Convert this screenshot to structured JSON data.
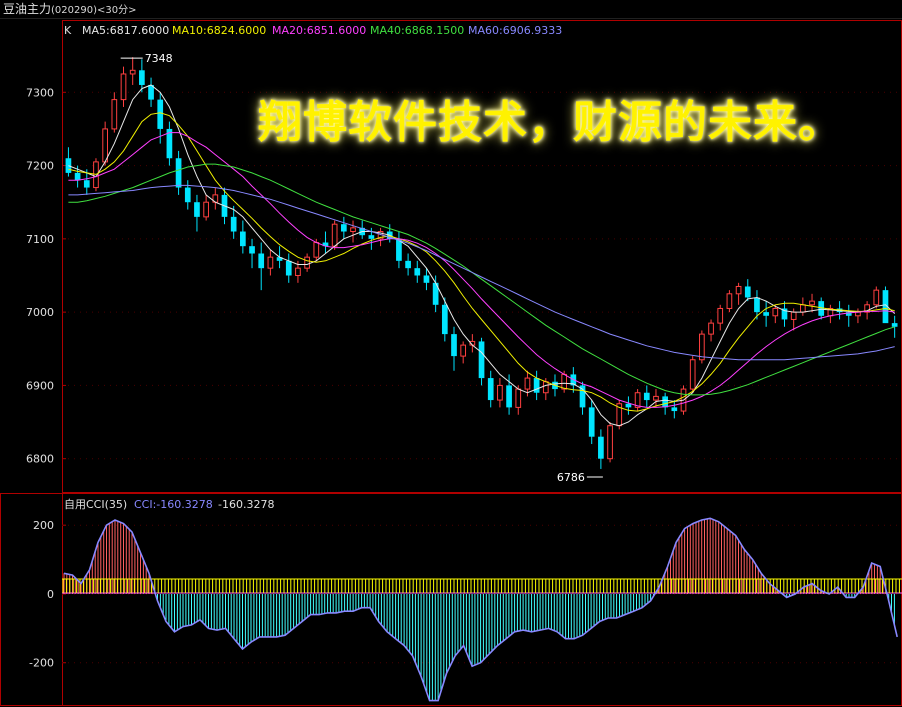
{
  "header": {
    "instrument": "豆油主力",
    "code": "(020290)",
    "period": "<30分>"
  },
  "banner_text": "翔博软件技术，财源的未来。",
  "main_panel": {
    "prefix": "K",
    "ma_legend": [
      {
        "label": "MA5:6817.6000",
        "color": "#e8e8e8"
      },
      {
        "label": "MA10:6824.6000",
        "color": "#f0f000"
      },
      {
        "label": "MA20:6851.6000",
        "color": "#ff40ff"
      },
      {
        "label": "MA40:6868.1500",
        "color": "#40e040"
      },
      {
        "label": "MA60:6906.9333",
        "color": "#8888ff"
      }
    ],
    "high_label": "7348",
    "low_label": "6786"
  },
  "cci_panel": {
    "title": "自用CCI(35)",
    "cci_label": "CCI:-160.3278",
    "cci_value": "-160.3278"
  },
  "colors": {
    "up": "#ff4040",
    "down": "#00e5ff",
    "frame": "#b00000",
    "cci_line": "#8888ff",
    "cci_pos": "#ff6060",
    "cci_neg": "#40ffff",
    "band": "#ffff00",
    "band_edge": "#ff60ff"
  },
  "chart_data": [
    {
      "type": "candlestick",
      "yticks": [
        6800,
        6900,
        7000,
        7100,
        7200,
        7300
      ],
      "ylim": [
        6760,
        7385
      ],
      "candles": [
        [
          7210,
          7225,
          7185,
          7190
        ],
        [
          7190,
          7200,
          7170,
          7180
        ],
        [
          7180,
          7195,
          7160,
          7170
        ],
        [
          7170,
          7210,
          7165,
          7205
        ],
        [
          7205,
          7260,
          7200,
          7250
        ],
        [
          7250,
          7300,
          7245,
          7290
        ],
        [
          7290,
          7335,
          7280,
          7325
        ],
        [
          7325,
          7348,
          7310,
          7330
        ],
        [
          7330,
          7345,
          7300,
          7310
        ],
        [
          7310,
          7320,
          7280,
          7290
        ],
        [
          7290,
          7300,
          7230,
          7250
        ],
        [
          7250,
          7260,
          7200,
          7210
        ],
        [
          7210,
          7220,
          7160,
          7170
        ],
        [
          7170,
          7180,
          7140,
          7150
        ],
        [
          7150,
          7160,
          7110,
          7130
        ],
        [
          7130,
          7160,
          7125,
          7150
        ],
        [
          7150,
          7170,
          7140,
          7160
        ],
        [
          7160,
          7170,
          7120,
          7130
        ],
        [
          7130,
          7145,
          7100,
          7110
        ],
        [
          7110,
          7125,
          7080,
          7090
        ],
        [
          7090,
          7100,
          7060,
          7080
        ],
        [
          7080,
          7095,
          7030,
          7060
        ],
        [
          7060,
          7085,
          7050,
          7075
        ],
        [
          7075,
          7090,
          7060,
          7070
        ],
        [
          7070,
          7080,
          7040,
          7050
        ],
        [
          7050,
          7070,
          7040,
          7060
        ],
        [
          7060,
          7080,
          7055,
          7075
        ],
        [
          7075,
          7100,
          7070,
          7095
        ],
        [
          7095,
          7110,
          7080,
          7090
        ],
        [
          7090,
          7125,
          7085,
          7120
        ],
        [
          7120,
          7130,
          7100,
          7110
        ],
        [
          7110,
          7125,
          7095,
          7115
        ],
        [
          7115,
          7125,
          7100,
          7105
        ],
        [
          7105,
          7115,
          7085,
          7100
        ],
        [
          7100,
          7115,
          7090,
          7110
        ],
        [
          7110,
          7120,
          7095,
          7100
        ],
        [
          7100,
          7110,
          7060,
          7070
        ],
        [
          7070,
          7080,
          7050,
          7060
        ],
        [
          7060,
          7070,
          7040,
          7050
        ],
        [
          7050,
          7060,
          7030,
          7040
        ],
        [
          7040,
          7050,
          7000,
          7010
        ],
        [
          7010,
          7020,
          6960,
          6970
        ],
        [
          6970,
          6980,
          6920,
          6940
        ],
        [
          6940,
          6960,
          6930,
          6955
        ],
        [
          6955,
          6970,
          6945,
          6960
        ],
        [
          6960,
          6965,
          6900,
          6910
        ],
        [
          6910,
          6920,
          6870,
          6880
        ],
        [
          6880,
          6910,
          6870,
          6900
        ],
        [
          6900,
          6915,
          6860,
          6870
        ],
        [
          6870,
          6900,
          6860,
          6895
        ],
        [
          6895,
          6920,
          6885,
          6910
        ],
        [
          6910,
          6920,
          6880,
          6890
        ],
        [
          6890,
          6910,
          6880,
          6905
        ],
        [
          6905,
          6915,
          6885,
          6895
        ],
        [
          6895,
          6920,
          6890,
          6915
        ],
        [
          6915,
          6925,
          6890,
          6900
        ],
        [
          6900,
          6905,
          6860,
          6870
        ],
        [
          6870,
          6880,
          6820,
          6830
        ],
        [
          6830,
          6840,
          6786,
          6800
        ],
        [
          6800,
          6850,
          6795,
          6845
        ],
        [
          6845,
          6880,
          6840,
          6875
        ],
        [
          6875,
          6885,
          6860,
          6870
        ],
        [
          6870,
          6895,
          6865,
          6890
        ],
        [
          6890,
          6900,
          6870,
          6880
        ],
        [
          6880,
          6895,
          6870,
          6885
        ],
        [
          6885,
          6890,
          6860,
          6870
        ],
        [
          6870,
          6880,
          6855,
          6865
        ],
        [
          6865,
          6900,
          6860,
          6895
        ],
        [
          6895,
          6940,
          6890,
          6935
        ],
        [
          6935,
          6975,
          6930,
          6970
        ],
        [
          6970,
          6990,
          6960,
          6985
        ],
        [
          6985,
          7010,
          6975,
          7005
        ],
        [
          7005,
          7030,
          7000,
          7025
        ],
        [
          7025,
          7040,
          7010,
          7035
        ],
        [
          7035,
          7045,
          7015,
          7020
        ],
        [
          7020,
          7030,
          6990,
          7000
        ],
        [
          7000,
          7015,
          6980,
          6995
        ],
        [
          6995,
          7010,
          6985,
          7005
        ],
        [
          7005,
          7015,
          6980,
          6990
        ],
        [
          6990,
          7005,
          6975,
          7000
        ],
        [
          7000,
          7020,
          6995,
          7010
        ],
        [
          7010,
          7025,
          7000,
          7015
        ],
        [
          7015,
          7020,
          6990,
          6995
        ],
        [
          6995,
          7010,
          6985,
          7005
        ],
        [
          7005,
          7015,
          6990,
          7000
        ],
        [
          7000,
          7010,
          6980,
          6995
        ],
        [
          6995,
          7005,
          6985,
          7000
        ],
        [
          7000,
          7015,
          6990,
          7010
        ],
        [
          7010,
          7035,
          7005,
          7030
        ],
        [
          7030,
          7035,
          6990,
          6985
        ],
        [
          6985,
          6995,
          6965,
          6980
        ]
      ],
      "moving_averages": [
        {
          "name": "MA5",
          "values": [
            7200,
            7195,
            7190,
            7185,
            7205,
            7230,
            7260,
            7290,
            7305,
            7310,
            7300,
            7280,
            7250,
            7215,
            7185,
            7160,
            7150,
            7145,
            7140,
            7130,
            7115,
            7100,
            7085,
            7075,
            7070,
            7065,
            7065,
            7070,
            7080,
            7090,
            7100,
            7105,
            7110,
            7110,
            7108,
            7105,
            7098,
            7090,
            7075,
            7060,
            7040,
            7015,
            6990,
            6970,
            6955,
            6945,
            6930,
            6915,
            6905,
            6895,
            6890,
            6895,
            6900,
            6902,
            6903,
            6902,
            6895,
            6880,
            6860,
            6848,
            6845,
            6850,
            6860,
            6868,
            6878,
            6880,
            6878,
            6880,
            6890,
            6910,
            6935,
            6960,
            6985,
            7005,
            7018,
            7020,
            7015,
            7008,
            7002,
            7000,
            7000,
            7002,
            7004,
            7003,
            7002,
            7001,
            7000,
            7002,
            7008,
            7010,
            6998
          ]
        },
        {
          "name": "MA10",
          "values": [
            7195,
            7192,
            7190,
            7188,
            7195,
            7205,
            7220,
            7240,
            7260,
            7270,
            7272,
            7268,
            7255,
            7240,
            7220,
            7200,
            7180,
            7165,
            7152,
            7140,
            7128,
            7115,
            7103,
            7092,
            7083,
            7075,
            7070,
            7068,
            7070,
            7075,
            7080,
            7087,
            7093,
            7098,
            7102,
            7104,
            7100,
            7096,
            7090,
            7082,
            7070,
            7056,
            7040,
            7022,
            7005,
            6990,
            6975,
            6960,
            6945,
            6930,
            6918,
            6910,
            6905,
            6900,
            6896,
            6894,
            6893,
            6890,
            6884,
            6876,
            6870,
            6866,
            6865,
            6868,
            6872,
            6875,
            6878,
            6884,
            6892,
            6902,
            6915,
            6930,
            6948,
            6965,
            6980,
            6995,
            7005,
            7010,
            7012,
            7012,
            7010,
            7008,
            7006,
            7004,
            7003,
            7002,
            7001,
            7001,
            7003,
            7005,
            7002
          ]
        },
        {
          "name": "MA20",
          "values": [
            7180,
            7180,
            7182,
            7185,
            7190,
            7195,
            7205,
            7215,
            7225,
            7235,
            7240,
            7245,
            7245,
            7240,
            7232,
            7225,
            7215,
            7205,
            7195,
            7185,
            7172,
            7160,
            7148,
            7135,
            7123,
            7112,
            7102,
            7095,
            7090,
            7088,
            7088,
            7090,
            7092,
            7095,
            7098,
            7100,
            7100,
            7098,
            7094,
            7088,
            7080,
            7070,
            7058,
            7045,
            7032,
            7018,
            7005,
            6992,
            6979,
            6966,
            6954,
            6942,
            6932,
            6923,
            6915,
            6908,
            6902,
            6898,
            6892,
            6886,
            6880,
            6876,
            6872,
            6870,
            6870,
            6871,
            6873,
            6876,
            6880,
            6885,
            6892,
            6900,
            6910,
            6921,
            6932,
            6943,
            6953,
            6962,
            6970,
            6977,
            6983,
            6988,
            6992,
            6995,
            6997,
            6999,
            7000,
            7001,
            7001,
            7002,
            7000
          ]
        },
        {
          "name": "MA40",
          "values": [
            7150,
            7150,
            7152,
            7155,
            7158,
            7162,
            7166,
            7170,
            7175,
            7180,
            7185,
            7190,
            7194,
            7198,
            7200,
            7202,
            7202,
            7200,
            7198,
            7194,
            7190,
            7185,
            7180,
            7174,
            7168,
            7162,
            7156,
            7150,
            7145,
            7140,
            7135,
            7130,
            7126,
            7122,
            7118,
            7114,
            7110,
            7106,
            7100,
            7094,
            7087,
            7079,
            7071,
            7063,
            7054,
            7045,
            7036,
            7027,
            7018,
            7009,
            7000,
            6991,
            6982,
            6974,
            6966,
            6958,
            6950,
            6943,
            6936,
            6929,
            6922,
            6915,
            6909,
            6903,
            6898,
            6893,
            6890,
            6888,
            6887,
            6887,
            6888,
            6890,
            6893,
            6897,
            6901,
            6906,
            6911,
            6916,
            6921,
            6926,
            6931,
            6936,
            6941,
            6946,
            6951,
            6956,
            6961,
            6966,
            6971,
            6976,
            6980
          ]
        },
        {
          "name": "MA60",
          "values": [
            7160,
            7160,
            7161,
            7162,
            7163,
            7164,
            7165,
            7166,
            7168,
            7170,
            7171,
            7172,
            7173,
            7173,
            7172,
            7171,
            7170,
            7168,
            7166,
            7163,
            7160,
            7157,
            7154,
            7150,
            7146,
            7142,
            7138,
            7134,
            7130,
            7126,
            7122,
            7118,
            7114,
            7110,
            7106,
            7102,
            7098,
            7094,
            7089,
            7084,
            7078,
            7072,
            7066,
            7060,
            7054,
            7048,
            7042,
            7036,
            7030,
            7024,
            7018,
            7012,
            7006,
            7000,
            6995,
            6990,
            6985,
            6980,
            6975,
            6970,
            6966,
            6962,
            6958,
            6954,
            6951,
            6948,
            6945,
            6943,
            6941,
            6939,
            6938,
            6937,
            6936,
            6935,
            6935,
            6935,
            6935,
            6935,
            6935,
            6936,
            6937,
            6938,
            6939,
            6940,
            6941,
            6942,
            6943,
            6945,
            6947,
            6950,
            6953
          ]
        }
      ]
    },
    {
      "type": "line",
      "title": "自用CCI(35)",
      "yticks": [
        -200,
        0,
        200
      ],
      "ylim": [
        -320,
        250
      ],
      "series": [
        {
          "name": "CCI",
          "values": [
            60,
            55,
            30,
            70,
            150,
            200,
            215,
            205,
            180,
            120,
            60,
            -20,
            -80,
            -110,
            -95,
            -90,
            -75,
            -100,
            -105,
            -100,
            -130,
            -160,
            -140,
            -125,
            -125,
            -125,
            -120,
            -100,
            -80,
            -60,
            -60,
            -55,
            -55,
            -50,
            -50,
            -40,
            -40,
            -80,
            -110,
            -130,
            -150,
            -180,
            -240,
            -310,
            -310,
            -230,
            -180,
            -150,
            -210,
            -200,
            -175,
            -150,
            -130,
            -110,
            -105,
            -110,
            -105,
            -100,
            -110,
            -130,
            -130,
            -120,
            -100,
            -80,
            -70,
            -70,
            -60,
            -50,
            -40,
            -20,
            20,
            80,
            150,
            190,
            205,
            215,
            220,
            210,
            190,
            170,
            130,
            100,
            60,
            30,
            10,
            -10,
            0,
            20,
            30,
            10,
            0,
            20,
            -10,
            -10,
            20,
            90,
            80,
            -20,
            -125
          ]
        }
      ]
    }
  ]
}
